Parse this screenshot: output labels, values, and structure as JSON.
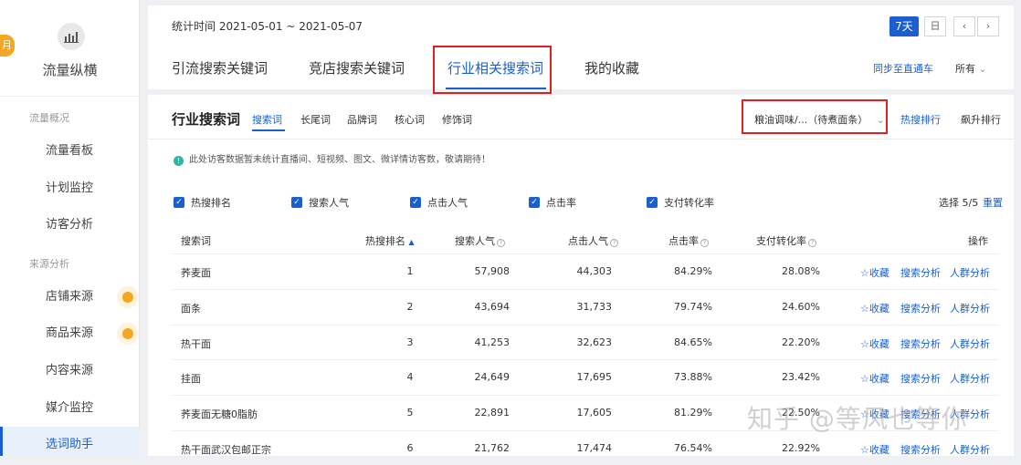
{
  "sidebar": {
    "side_tab": "月",
    "title": "流量纵横",
    "sections": [
      "流量概况",
      "来源分析"
    ],
    "items": [
      "流量看板",
      "计划监控",
      "访客分析",
      "店铺来源",
      "商品来源",
      "内容来源",
      "媒介监控",
      "选词助手"
    ]
  },
  "header": {
    "date_range": "统计时间 2021-05-01 ~ 2021-05-07",
    "btn_7day": "7天",
    "btn_day": "日",
    "tabs": [
      "引流搜索关键词",
      "竞店搜索关键词",
      "行业相关搜索词",
      "我的收藏"
    ],
    "sync": "同步至直通车",
    "filter": "所有"
  },
  "main": {
    "title": "行业搜索词",
    "subtabs": [
      "搜索词",
      "长尾词",
      "品牌词",
      "核心词",
      "修饰词"
    ],
    "category": "粮油调味/...（待煮面条）",
    "hot_sort": "热搜排行",
    "rise_sort": "飙升排行",
    "notice": "此处访客数据暂未统计直播间、短视频、图文、微详情访客数，敬请期待！",
    "checkboxes": [
      "热搜排名",
      "搜索人气",
      "点击人气",
      "点击率",
      "支付转化率"
    ],
    "selected": "选择 5/5",
    "reset": "重置",
    "columns": [
      "搜索词",
      "热搜排名",
      "搜索人气",
      "点击人气",
      "点击率",
      "支付转化率",
      "操作"
    ],
    "rows": [
      [
        "荞麦面",
        "1",
        "57,908",
        "44,303",
        "84.29%",
        "28.08%"
      ],
      [
        "面条",
        "2",
        "43,694",
        "31,733",
        "79.74%",
        "24.60%"
      ],
      [
        "热干面",
        "3",
        "41,253",
        "32,623",
        "84.65%",
        "22.20%"
      ],
      [
        "挂面",
        "4",
        "24,649",
        "17,695",
        "73.88%",
        "23.42%"
      ],
      [
        "荞麦面无糖0脂肪",
        "5",
        "22,891",
        "17,605",
        "81.29%",
        "22.50%"
      ],
      [
        "热干面武汉包邮正宗",
        "6",
        "21,762",
        "17,474",
        "76.54%",
        "22.92%"
      ]
    ],
    "actions": [
      "☆收藏",
      "搜索分析",
      "人群分析"
    ]
  },
  "watermark": "知乎 @等风也等你"
}
